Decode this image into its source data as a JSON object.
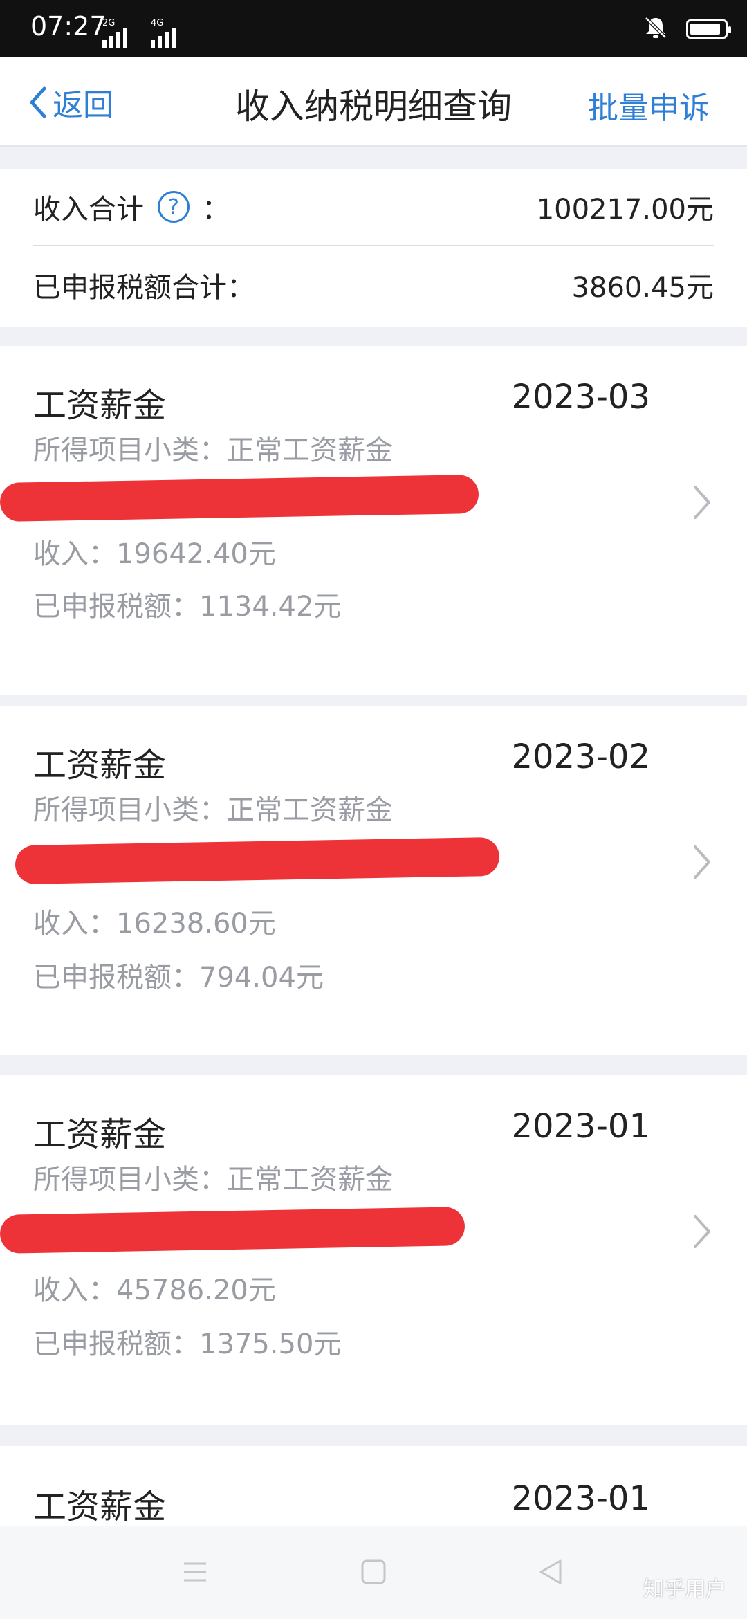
{
  "status_bar": {
    "time": "07:27",
    "signal_tags": [
      "2G",
      "4G"
    ],
    "battery_level": 0.9
  },
  "nav": {
    "back_label": "返回",
    "title": "收入纳税明细查询",
    "action_label": "批量申诉"
  },
  "summary": {
    "income_label": "收入合计",
    "income_colon": "：",
    "income_value": "100217.00元",
    "tax_label": "已申报税额合计：",
    "tax_value": "3860.45元"
  },
  "records": [
    {
      "type": "工资薪金",
      "month": "2023-03",
      "subcategory": "所得项目小类：正常工资薪金",
      "income": "收入：19642.40元",
      "tax": "已申报税额：1134.42元"
    },
    {
      "type": "工资薪金",
      "month": "2023-02",
      "subcategory": "所得项目小类：正常工资薪金",
      "income": "收入：16238.60元",
      "tax": "已申报税额：794.04元"
    },
    {
      "type": "工资薪金",
      "month": "2023-01",
      "subcategory": "所得项目小类：正常工资薪金",
      "income": "收入：45786.20元",
      "tax": "已申报税额：1375.50元"
    },
    {
      "type": "工资薪金",
      "month": "2023-01"
    }
  ],
  "watermark": "知乎用户",
  "colors": {
    "accent": "#2f7fd6",
    "redaction": "#ee3338",
    "secondary_text": "#9a9ca4"
  }
}
